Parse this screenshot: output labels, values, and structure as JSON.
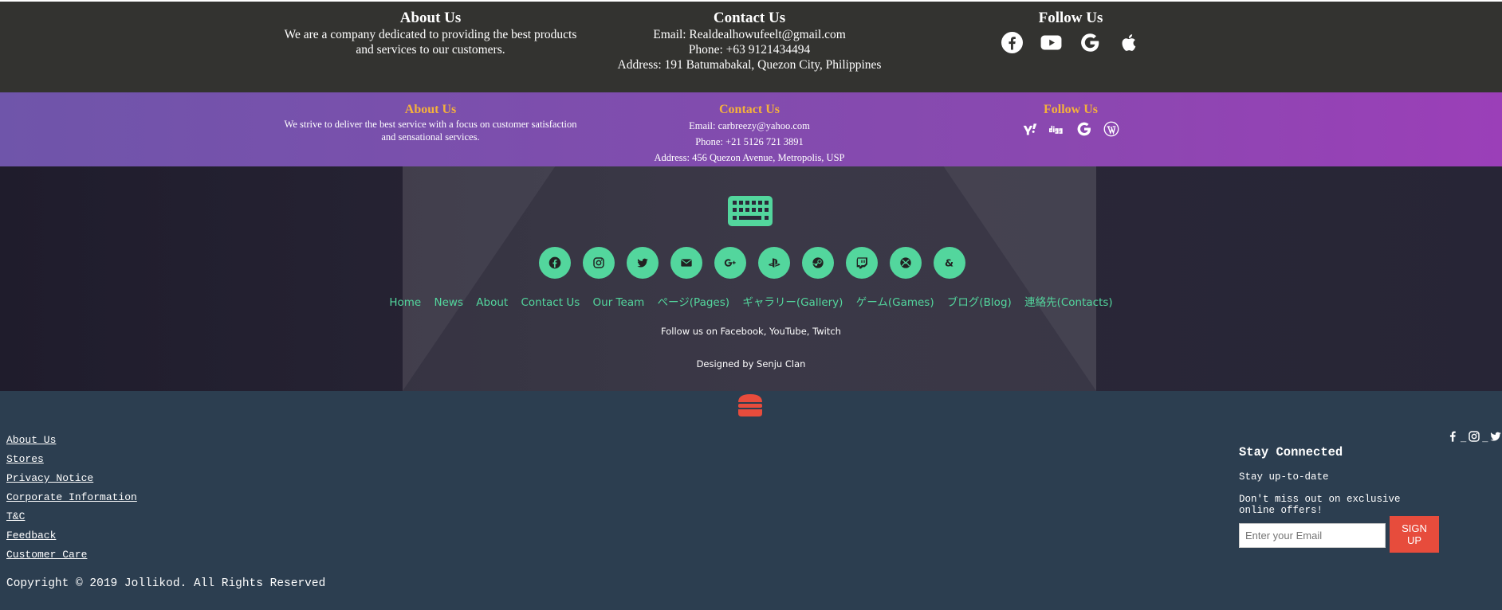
{
  "section1": {
    "about": {
      "title": "About Us",
      "text": [
        "We are a company dedicated to providing the best products",
        "and services to our customers."
      ]
    },
    "contact": {
      "title": "Contact Us",
      "email": "Email: Realdealhowufeelt@gmail.com",
      "phone": "Phone: +63 9121434494",
      "address": "Address: 191 Batumabakal, Quezon City, Philippines"
    },
    "follow": {
      "title": "Follow Us",
      "icons": [
        "facebook-icon",
        "youtube-icon",
        "google-icon",
        "apple-icon"
      ]
    }
  },
  "section2": {
    "about": {
      "title": "About Us",
      "text": [
        "We strive to deliver the best service with a focus on customer satisfaction",
        "and sensational services."
      ]
    },
    "contact": {
      "title": "Contact Us",
      "email": "Email: carbreezy@yahoo.com",
      "phone": "Phone: +21 5126 721 3891",
      "address": "Address: 456 Quezon Avenue, Metropolis, USP"
    },
    "follow": {
      "title": "Follow Us",
      "icons": [
        "yahoo-icon",
        "digg-icon",
        "google-icon",
        "wordpress-icon"
      ]
    }
  },
  "section3": {
    "logo_icon": "keyboard-icon",
    "social_icons": [
      "facebook-icon",
      "instagram-icon",
      "twitter-icon",
      "envelope-icon",
      "google-plus-icon",
      "playstation-icon",
      "steam-icon",
      "twitch-icon",
      "xbox-icon",
      "ampersand-icon"
    ],
    "nav": [
      "Home",
      "News",
      "About",
      "Contact Us",
      "Our Team",
      "ページ(Pages)",
      "ギャラリー(Gallery)",
      "ゲーム(Games)",
      "ブログ(Blog)",
      "連絡先(Contacts)"
    ],
    "follow_text": "Follow us on Facebook, YouTube, Twitch",
    "designed_text": "Designed by Senju Clan",
    "accent": "#53d69d"
  },
  "section4": {
    "logo_icon": "burger-icon",
    "links": [
      "About Us",
      "Stores",
      "Privacy Notice",
      "Corporate Information",
      "T&C",
      "Feedback",
      "Customer Care"
    ],
    "copyright": "Copyright © 2019 Jollikod. All Rights Reserved",
    "stay": {
      "title": "Stay Connected",
      "subtitle": "Stay up-to-date",
      "desc": "Don't miss out on exclusive online offers!"
    },
    "email_placeholder": "Enter your Email",
    "signup_label": "SIGN UP",
    "social_icons": [
      "facebook-icon",
      "instagram-icon",
      "twitter-icon"
    ],
    "accent": "#e74c3c"
  }
}
